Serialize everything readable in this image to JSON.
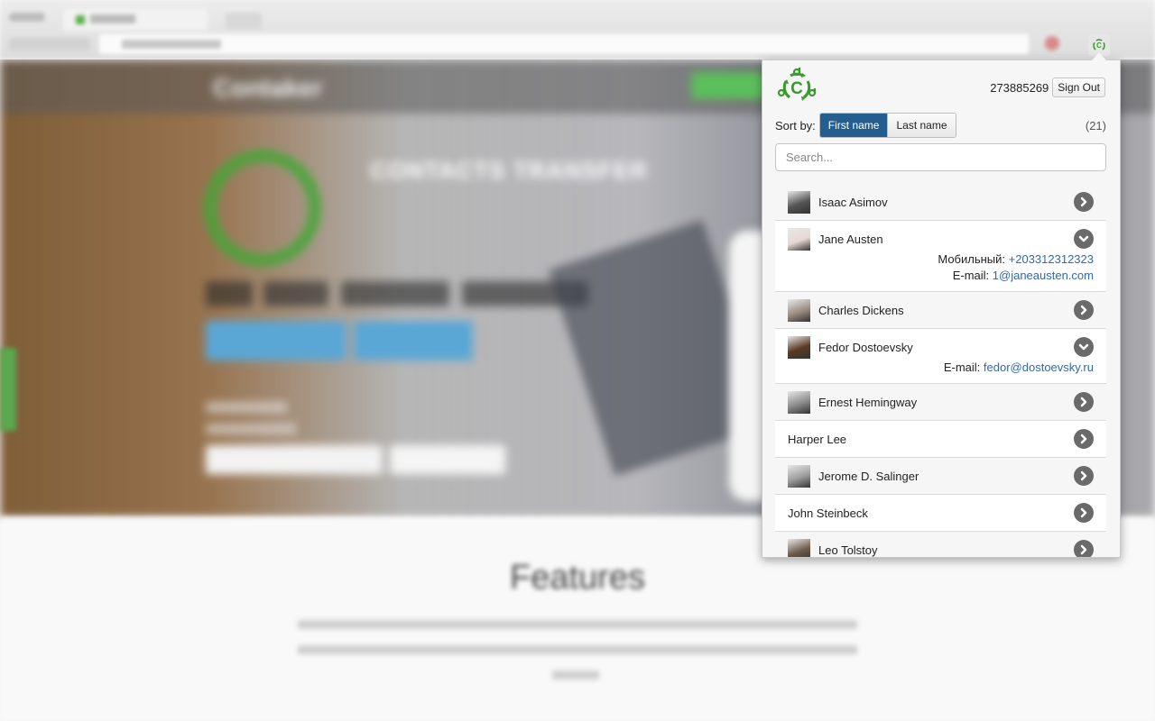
{
  "browser": {
    "tab_title": "Contaker",
    "extension_icon": "contaker-logo-icon"
  },
  "background_page": {
    "brand": "Contaker",
    "headline": "CONTACTS TRANSFER",
    "section_title": "Features"
  },
  "popup": {
    "logo": "contaker-logo-icon",
    "account_id": "273885269",
    "sign_out_label": "Sign Out",
    "sort_label": "Sort by:",
    "sort_options": [
      {
        "label": "First name",
        "active": true
      },
      {
        "label": "Last name",
        "active": false
      }
    ],
    "count": "(21)",
    "search_placeholder": "Search...",
    "contacts": [
      {
        "name": "Isaac Asimov",
        "has_avatar": true,
        "avatar_color": "#555555",
        "expanded": false,
        "toggle_icon": "chevron-right-circle-icon"
      },
      {
        "name": "Jane Austen",
        "has_avatar": true,
        "avatar_color": "#e6d8d2",
        "expanded": true,
        "toggle_icon": "chevron-down-circle-icon",
        "details": [
          {
            "label": "Мобильный:",
            "value": "+203312312323"
          },
          {
            "label": "E-mail:",
            "value": "1@janeausten.com"
          }
        ]
      },
      {
        "name": "Charles Dickens",
        "has_avatar": true,
        "avatar_color": "#9a8c80",
        "expanded": false,
        "toggle_icon": "chevron-right-circle-icon"
      },
      {
        "name": "Fedor Dostoevsky",
        "has_avatar": true,
        "avatar_color": "#5a3a22",
        "expanded": true,
        "toggle_icon": "chevron-down-circle-icon",
        "details": [
          {
            "label": "E-mail:",
            "value": "fedor@dostoevsky.ru"
          }
        ]
      },
      {
        "name": "Ernest Hemingway",
        "has_avatar": true,
        "avatar_color": "#8a8a8a",
        "expanded": false,
        "toggle_icon": "chevron-right-circle-icon"
      },
      {
        "name": "Harper Lee",
        "has_avatar": false,
        "expanded": false,
        "toggle_icon": "chevron-right-circle-icon"
      },
      {
        "name": "Jerome D. Salinger",
        "has_avatar": true,
        "avatar_color": "#9c9c9c",
        "expanded": false,
        "toggle_icon": "chevron-right-circle-icon"
      },
      {
        "name": "John Steinbeck",
        "has_avatar": false,
        "expanded": false,
        "toggle_icon": "chevron-right-circle-icon"
      },
      {
        "name": "Leo Tolstoy",
        "has_avatar": true,
        "avatar_color": "#6b5a4a",
        "expanded": false,
        "toggle_icon": "chevron-right-circle-icon"
      }
    ]
  },
  "colors": {
    "brand_green": "#3a9a2e",
    "sort_active": "#245e91",
    "link": "#2a6bb3",
    "toggle": "#6a6a6a"
  }
}
